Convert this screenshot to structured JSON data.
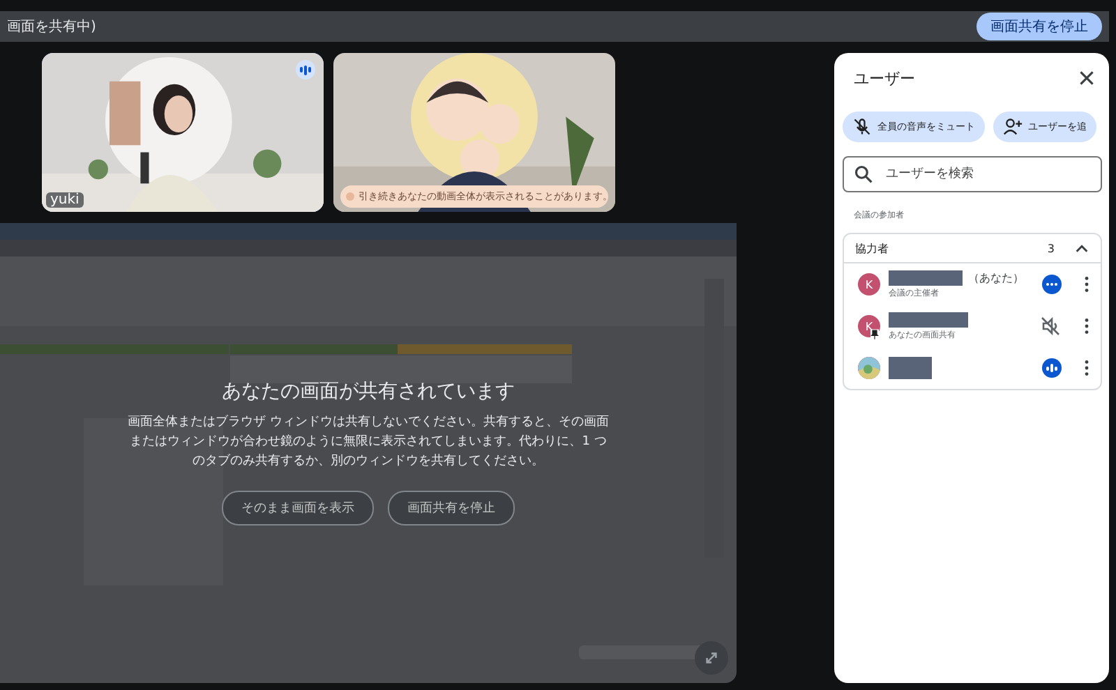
{
  "share_bar": {
    "label": "画面を共有中)",
    "stop_button": "画面共有を停止"
  },
  "tiles": [
    {
      "kind": "person",
      "name": "yuki",
      "speaking": true
    },
    {
      "kind": "illustration",
      "caption": "引き続きあなたの動画全体が表示されることがあります。"
    }
  ],
  "presentation": {
    "title": "あなたの画面が共有されています",
    "message": "画面全体またはブラウザ ウィンドウは共有しないでください。共有すると、その画面またはウィンドウが合わせ鏡のように無限に表示されてしまいます。代わりに、1 つのタブのみ共有するか、別のウィンドウを共有してください。",
    "buttons": [
      "そのまま画面を表示",
      "画面共有を停止"
    ]
  },
  "panel": {
    "title": "ユーザー",
    "actions": [
      {
        "kind": "mute",
        "label": "全員の音声をミュート"
      },
      {
        "kind": "add",
        "label": "ユーザーを追"
      }
    ],
    "search": {
      "placeholder": "ユーザーを検索"
    },
    "section": "会議の参加者",
    "group": {
      "label": "協力者",
      "count": "3",
      "expanded": true
    },
    "participants": [
      {
        "kind": "letter",
        "avatar": "K",
        "suffix": "（あなた）",
        "subtitle": "会議の主催者",
        "pinned": false,
        "muted": false,
        "speaking": false
      },
      {
        "kind": "letter",
        "avatar": "K",
        "subtitle": "あなたの画面共有",
        "pinned": true,
        "muted": true
      },
      {
        "kind": "picture",
        "pinned": false,
        "muted": false,
        "speaking": true
      }
    ]
  }
}
